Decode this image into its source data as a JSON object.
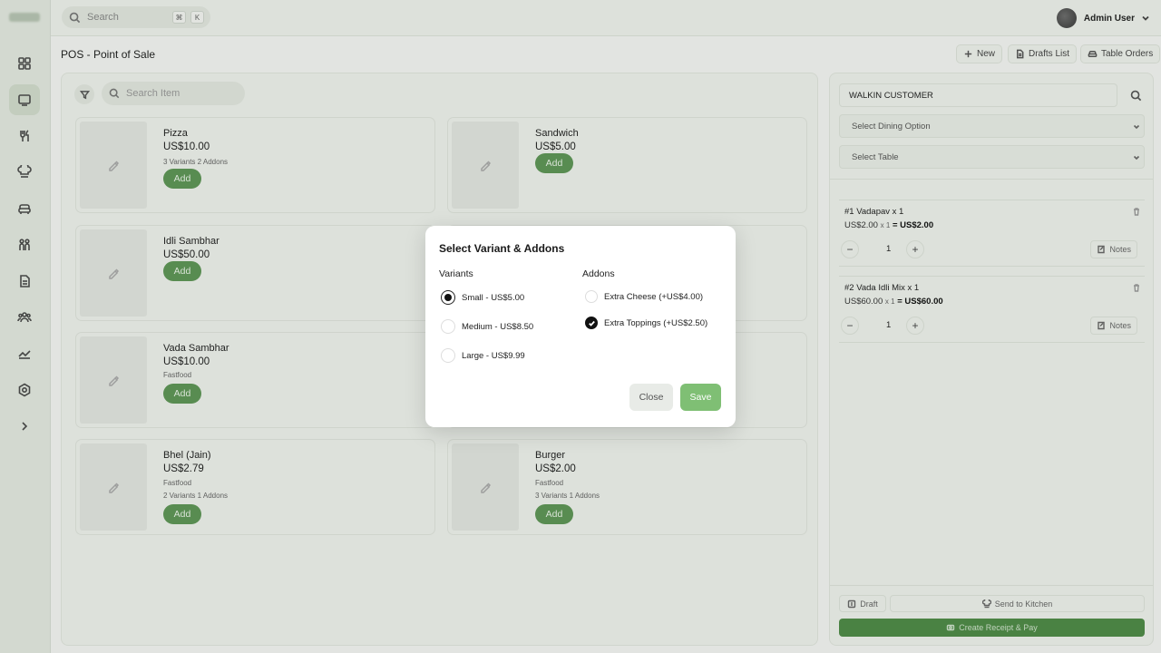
{
  "topbar": {
    "search_placeholder": "Search",
    "kbd_cmd": "⌘",
    "kbd_k": "K",
    "user_name": "Admin User"
  },
  "page": {
    "title": "POS - Point of Sale",
    "new_label": "New",
    "drafts_label": "Drafts List",
    "table_orders_label": "Table Orders"
  },
  "products": {
    "search_placeholder": "Search Item",
    "add_label": "Add",
    "items": [
      {
        "name": "Pizza",
        "price": "US$10.00",
        "meta1": "3 Variants 2 Addons",
        "meta2": ""
      },
      {
        "name": "Sandwich",
        "price": "US$5.00",
        "meta1": "",
        "meta2": ""
      },
      {
        "name": "Idli Sambhar",
        "price": "US$50.00",
        "meta1": "",
        "meta2": ""
      },
      {
        "name": "Vada Sambhar",
        "price": "US$10.00",
        "meta1": "Fastfood",
        "meta2": ""
      },
      {
        "name": "Bhel (Jain)",
        "price": "US$2.79",
        "meta1": "Fastfood",
        "meta2": "2 Variants 1 Addons"
      },
      {
        "name": "Burger",
        "price": "US$2.00",
        "meta1": "Fastfood",
        "meta2": "3 Variants 1 Addons"
      }
    ]
  },
  "order_panel": {
    "customer": "WALKIN CUSTOMER",
    "dining_placeholder": "Select Dining Option",
    "table_placeholder": "Select Table",
    "notes_label": "Notes",
    "orders": [
      {
        "title": "#1 Vadapav x 1",
        "unit": "US$2.00",
        "mult": "x 1",
        "eq": "=",
        "total": "US$2.00",
        "qty": "1"
      },
      {
        "title": "#2 Vada Idli Mix x 1",
        "unit": "US$60.00",
        "mult": "x 1",
        "eq": "=",
        "total": "US$60.00",
        "qty": "1"
      }
    ],
    "draft_label": "Draft",
    "kitchen_label": "Send to Kitchen",
    "pay_label": "Create Receipt & Pay"
  },
  "modal": {
    "title": "Select Variant & Addons",
    "variants_heading": "Variants",
    "addons_heading": "Addons",
    "variants": [
      {
        "label": "Small - US$5.00",
        "selected": true
      },
      {
        "label": "Medium - US$8.50",
        "selected": false
      },
      {
        "label": "Large - US$9.99",
        "selected": false
      }
    ],
    "addons": [
      {
        "label": "Extra Cheese (+US$4.00)",
        "checked": false
      },
      {
        "label": "Extra Toppings (+US$2.50)",
        "checked": true
      }
    ],
    "close_label": "Close",
    "save_label": "Save"
  },
  "colors": {
    "accent": "#5e9556",
    "save": "#7fbf74",
    "pay": "#4f8a47"
  }
}
